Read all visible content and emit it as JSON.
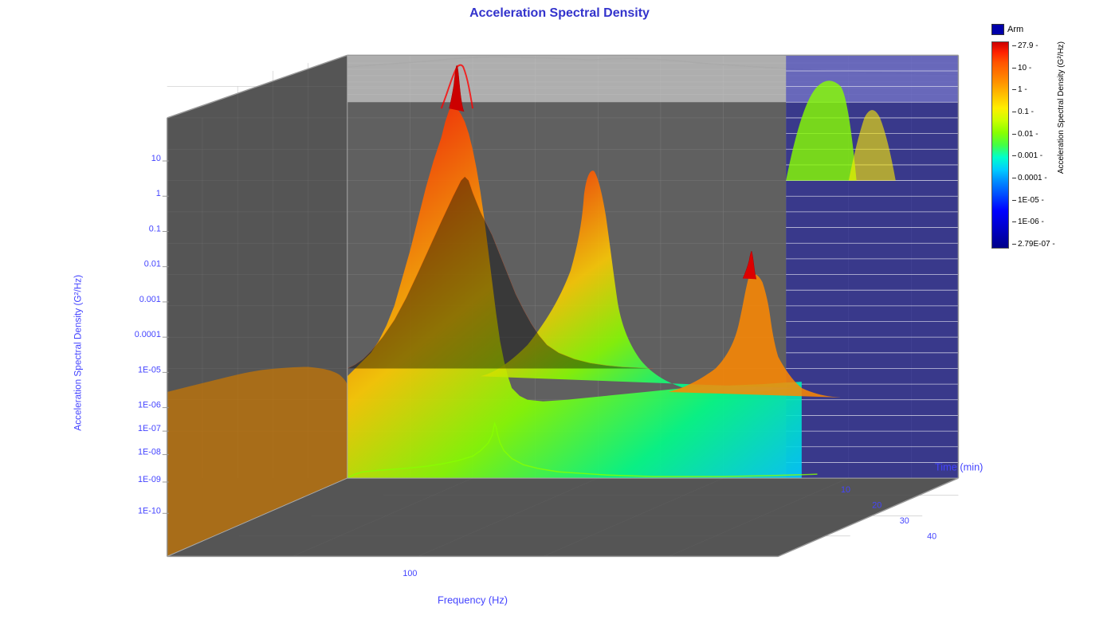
{
  "title": "Acceleration Spectral Density",
  "chart": {
    "x_axis_label": "Frequency (Hz)",
    "y_axis_label": "Acceleration Spectral Density (G²/Hz)",
    "z_axis_label": "Time (min)",
    "x_tick_100": "100",
    "z_ticks": [
      "10",
      "20",
      "30",
      "40"
    ],
    "y_ticks": [
      "10",
      "1",
      "0.1",
      "0.01",
      "0.001",
      "0.0001",
      "1E-05",
      "1E-06",
      "1E-07",
      "1E-08",
      "1E-09",
      "1E-10"
    ]
  },
  "legend": {
    "title": "Arm",
    "colorbar_title": "Acceleration Spectral Density (G²/Hz)",
    "labels": [
      {
        "value": "27.9",
        "dash": "-"
      },
      {
        "value": "10",
        "dash": "-"
      },
      {
        "value": "1",
        "dash": "-"
      },
      {
        "value": "0.1",
        "dash": "-"
      },
      {
        "value": "0.01",
        "dash": "-"
      },
      {
        "value": "0.001",
        "dash": "-"
      },
      {
        "value": "0.0001",
        "dash": "-"
      },
      {
        "value": "1E-05",
        "dash": "-"
      },
      {
        "value": "1E-06",
        "dash": "-"
      },
      {
        "value": "2.79E-07",
        "dash": "-"
      }
    ]
  }
}
